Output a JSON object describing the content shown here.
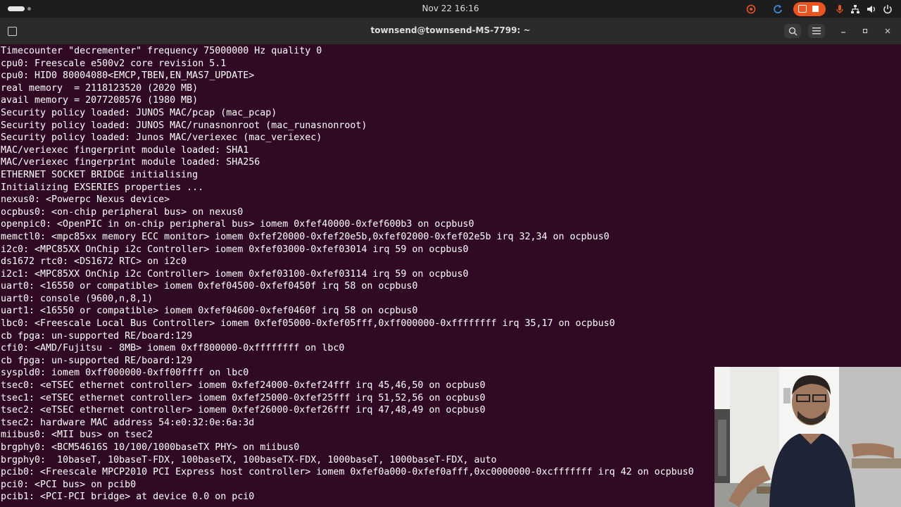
{
  "system_bar": {
    "clock": "Nov 22  16:16",
    "indicators": [
      "screen-record-icon",
      "refresh-icon",
      "stop-recording-icon",
      "microphone-icon",
      "network-icon",
      "volume-icon",
      "power-icon"
    ]
  },
  "window": {
    "title": "townsend@townsend-MS-7799: ~"
  },
  "terminal": {
    "lines": [
      "Timecounter \"decrementer\" frequency 75000000 Hz quality 0",
      "cpu0: Freescale e500v2 core revision 5.1",
      "cpu0: HID0 80004080<EMCP,TBEN,EN_MAS7_UPDATE>",
      "real memory  = 2118123520 (2020 MB)",
      "avail memory = 2077208576 (1980 MB)",
      "Security policy loaded: JUNOS MAC/pcap (mac_pcap)",
      "Security policy loaded: JUNOS MAC/runasnonroot (mac_runasnonroot)",
      "Security policy loaded: Junos MAC/veriexec (mac_veriexec)",
      "MAC/veriexec fingerprint module loaded: SHA1",
      "MAC/veriexec fingerprint module loaded: SHA256",
      "ETHERNET SOCKET BRIDGE initialising",
      "Initializing EXSERIES properties ...",
      "nexus0: <Powerpc Nexus device>",
      "ocpbus0: <on-chip peripheral bus> on nexus0",
      "openpic0: <OpenPIC in on-chip peripheral bus> iomem 0xfef40000-0xfef600b3 on ocpbus0",
      "memctl0: <mpc85xx memory ECC monitor> iomem 0xfef20000-0xfef20e5b,0xfef02000-0xfef02e5b irq 32,34 on ocpbus0",
      "i2c0: <MPC85XX OnChip i2c Controller> iomem 0xfef03000-0xfef03014 irq 59 on ocpbus0",
      "ds1672 rtc0: <DS1672 RTC> on i2c0",
      "i2c1: <MPC85XX OnChip i2c Controller> iomem 0xfef03100-0xfef03114 irq 59 on ocpbus0",
      "uart0: <16550 or compatible> iomem 0xfef04500-0xfef0450f irq 58 on ocpbus0",
      "uart0: console (9600,n,8,1)",
      "uart1: <16550 or compatible> iomem 0xfef04600-0xfef0460f irq 58 on ocpbus0",
      "lbc0: <Freescale Local Bus Controller> iomem 0xfef05000-0xfef05fff,0xff000000-0xffffffff irq 35,17 on ocpbus0",
      "cb fpga: un-supported RE/board:129",
      "cfi0: <AMD/Fujitsu - 8MB> iomem 0xff800000-0xffffffff on lbc0",
      "cb fpga: un-supported RE/board:129",
      "syspld0: iomem 0xff000000-0xff00ffff on lbc0",
      "tsec0: <eTSEC ethernet controller> iomem 0xfef24000-0xfef24fff irq 45,46,50 on ocpbus0",
      "tsec1: <eTSEC ethernet controller> iomem 0xfef25000-0xfef25fff irq 51,52,56 on ocpbus0",
      "tsec2: <eTSEC ethernet controller> iomem 0xfef26000-0xfef26fff irq 47,48,49 on ocpbus0",
      "tsec2: hardware MAC address 54:e0:32:0e:6a:3d",
      "miibus0: <MII bus> on tsec2",
      "brgphy0: <BCM54616S 10/100/1000baseTX PHY> on miibus0",
      "brgphy0:  10baseT, 10baseT-FDX, 100baseTX, 100baseTX-FDX, 1000baseT, 1000baseT-FDX, auto",
      "pcib0: <Freescale MPCP2010 PCI Express host controller> iomem 0xfef0a000-0xfef0afff,0xc0000000-0xcfffffff irq 42 on ocpbus0",
      "pci0: <PCI bus> on pcib0",
      "pcib1: <PCI-PCI bridge> at device 0.0 on pci0"
    ]
  },
  "colors": {
    "terminal_bg": "#300a24",
    "terminal_fg": "#ffffff",
    "top_bar_bg": "#1d1d1d",
    "header_bar_bg": "#2b2b2b",
    "accent": "#e95420"
  }
}
